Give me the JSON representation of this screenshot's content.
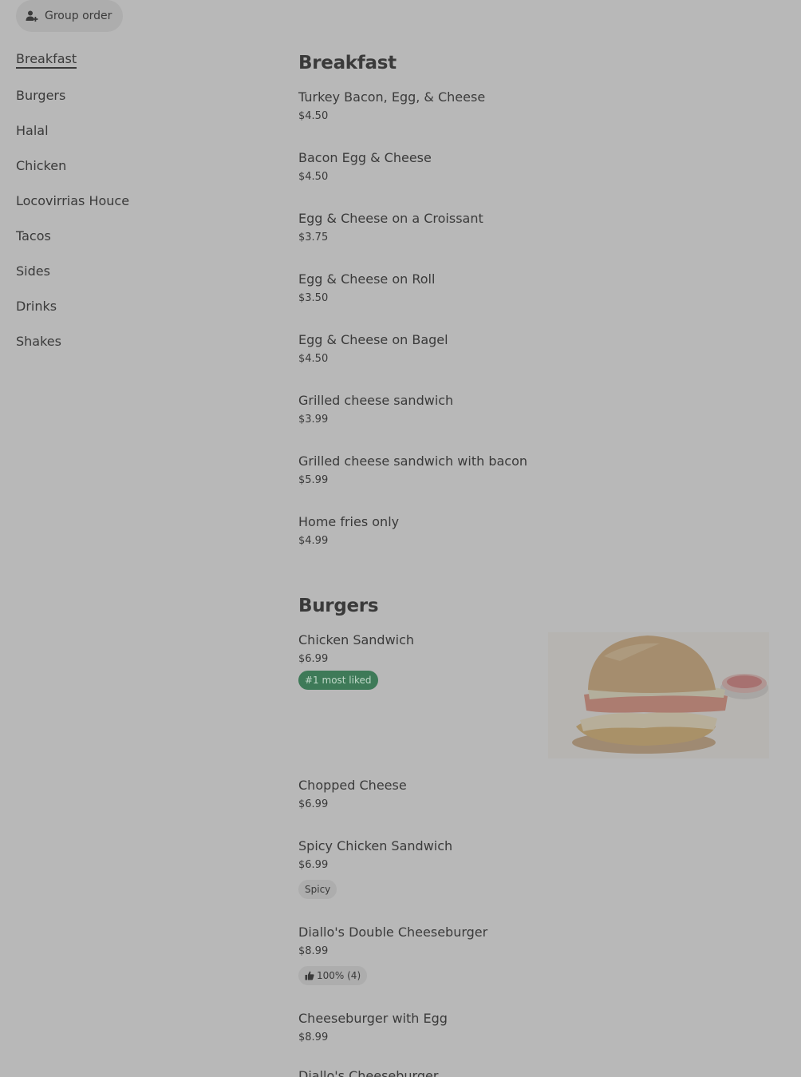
{
  "group_order": {
    "label": "Group order",
    "icon": "person-add-icon"
  },
  "sidebar": {
    "items": [
      {
        "label": "Breakfast",
        "active": true
      },
      {
        "label": "Burgers"
      },
      {
        "label": "Halal"
      },
      {
        "label": "Chicken"
      },
      {
        "label": "Locovirrias Houce"
      },
      {
        "label": "Tacos"
      },
      {
        "label": "Sides"
      },
      {
        "label": "Drinks"
      },
      {
        "label": "Shakes"
      }
    ]
  },
  "sections": [
    {
      "title": "Breakfast",
      "items": [
        {
          "name": "Turkey Bacon, Egg, & Cheese",
          "price": "$4.50"
        },
        {
          "name": "Bacon Egg & Cheese",
          "price": "$4.50"
        },
        {
          "name": "Egg & Cheese on a Croissant",
          "price": "$3.75"
        },
        {
          "name": "Egg & Cheese on Roll",
          "price": "$3.50"
        },
        {
          "name": "Egg & Cheese on Bagel",
          "price": "$4.50"
        },
        {
          "name": "Grilled cheese sandwich",
          "price": "$3.99"
        },
        {
          "name": "Grilled cheese sandwich with bacon",
          "price": "$5.99"
        },
        {
          "name": "Home fries only",
          "price": "$4.99"
        }
      ]
    },
    {
      "title": "Burgers",
      "items": [
        {
          "name": "Chicken Sandwich",
          "price": "$6.99",
          "badge": "#1 most liked",
          "image": "chicken-sandwich-photo"
        },
        {
          "name": "Chopped Cheese",
          "price": "$6.99"
        },
        {
          "name": "Spicy Chicken Sandwich",
          "price": "$6.99",
          "badge": "Spicy"
        },
        {
          "name": "Diallo's Double Cheeseburger",
          "price": "$8.99",
          "badge": "100% (4)",
          "badge_icon": "thumbs-up-icon"
        },
        {
          "name": "Cheeseburger with Egg",
          "price": "$8.99"
        },
        {
          "name": "Diallo's Cheeseburger"
        }
      ]
    }
  ],
  "colors": {
    "background": "#b8b8b8",
    "text": "#3a3a3a",
    "badge_green": "#3e7a58",
    "pill": "#adadad"
  }
}
